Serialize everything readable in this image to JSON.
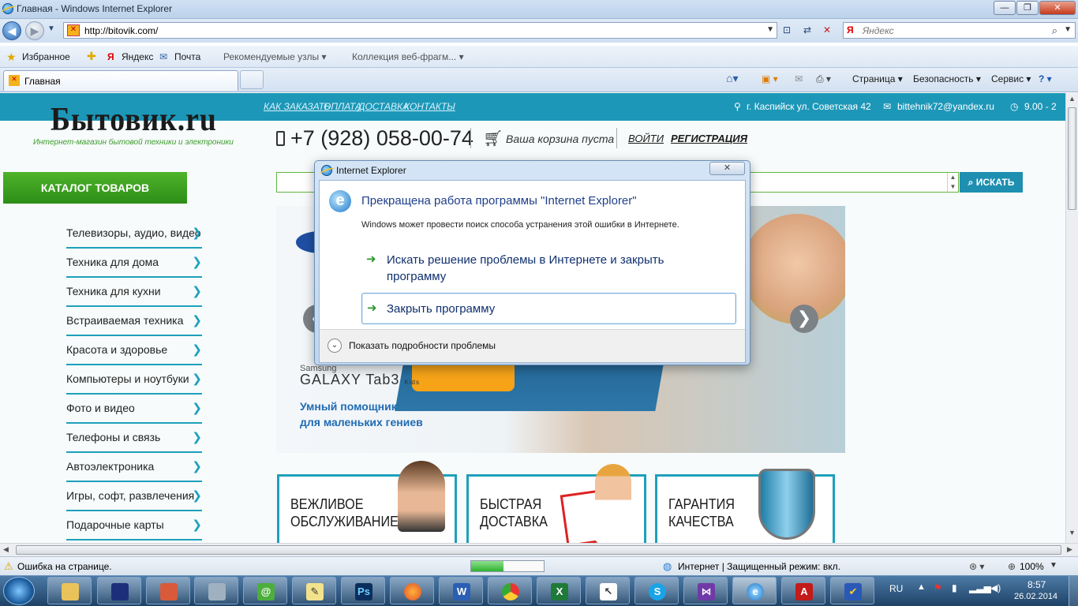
{
  "window": {
    "title": "Главная - Windows Internet Explorer",
    "buttons": [
      "—",
      "❐",
      "✕"
    ]
  },
  "address": {
    "url": "http://bitovik.com/",
    "search_placeholder": "Яндекс"
  },
  "favorites": {
    "label": "Избранное",
    "items": [
      "Яндекс",
      "Почта",
      "Рекомендуемые узлы ▾",
      "Коллекция веб-фрагм... ▾"
    ]
  },
  "tab": {
    "title": "Главная"
  },
  "commands": [
    "Страница ▾",
    "Безопасность ▾",
    "Сервис ▾"
  ],
  "site": {
    "top_links": [
      "КАК ЗАКАЗАТЬ",
      "ОПЛАТА",
      "ДОСТАВКА",
      "КОНТАКТЫ"
    ],
    "address": "г. Каспийск ул. Советская 42",
    "email": "bittehnik72@yandex.ru",
    "hours": "9.00 - 2",
    "logo": "Бытовик.ru",
    "tagline": "Интернет-магазин бытовой техники и электроники",
    "phone": "+7 (928) 058-00-74",
    "cart": "Ваша корзина пуста",
    "login": "ВОЙТИ",
    "register": "РЕГИСТРАЦИЯ",
    "search_button": "ИСКАТЬ",
    "catalog_title": "КАТАЛОГ ТОВАРОВ",
    "catalog": [
      "Телевизоры, аудио, видео",
      "Техника для дома",
      "Техника для кухни",
      "Встраиваемая техника",
      "Красота и здоровье",
      "Компьютеры и ноутбуки",
      "Фото и видео",
      "Телефоны и связь",
      "Автоэлектроника",
      "Игры, софт, развлечения",
      "Подарочные карты"
    ],
    "banner": {
      "brand": "Samsung",
      "product": "GALAXY Tab3",
      "product_suffix": "Kids",
      "slogan1": "Умный помощник",
      "slogan2": "для маленьких гениев"
    },
    "features": [
      {
        "line1": "ВЕЖЛИВОЕ",
        "line2": "ОБСЛУЖИВАНИЕ"
      },
      {
        "line1": "БЫСТРАЯ",
        "line2": "ДОСТАВКА"
      },
      {
        "line1": "ГАРАНТИЯ",
        "line2": "КАЧЕСТВА"
      }
    ]
  },
  "dialog": {
    "title": "Internet Explorer",
    "heading": "Прекращена работа программы \"Internet Explorer\"",
    "message": "Windows может провести поиск способа устранения этой ошибки в Интернете.",
    "option1_line1": "Искать решение проблемы в Интернете и закрыть",
    "option1_line2": "программу",
    "option2": "Закрыть программу",
    "details": "Показать подробности проблемы"
  },
  "status": {
    "left": "Ошибка на странице.",
    "zone": "Интернет | Защищенный режим: вкл.",
    "zoom": "100%",
    "progress": 0.45
  },
  "taskbar": {
    "lang": "RU",
    "time": "8:57",
    "date": "26.02.2014"
  },
  "colors": {
    "site_teal": "#1d97b8",
    "catalog_green": "#3ca11f",
    "dialog_link": "#10306e"
  }
}
